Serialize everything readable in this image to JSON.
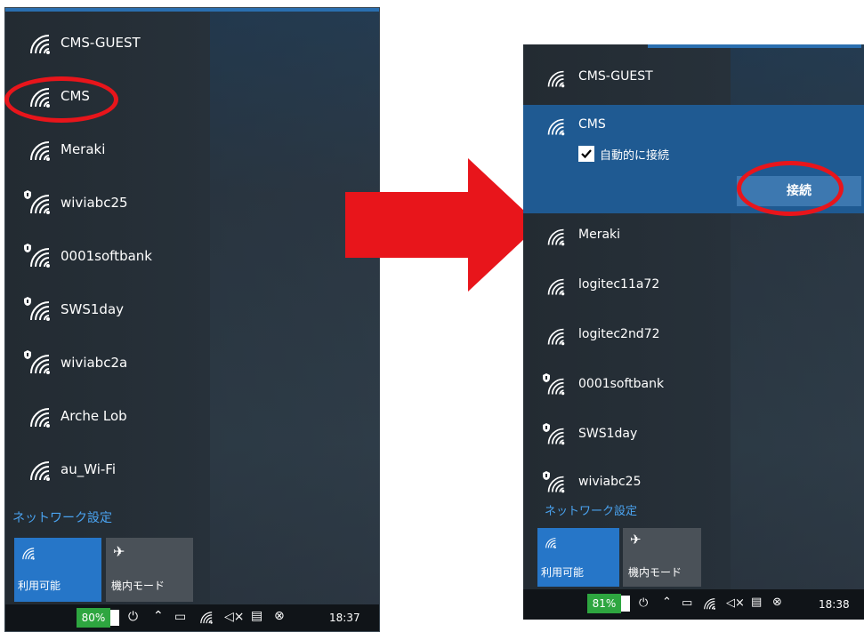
{
  "colors": {
    "accent": "#2676c8",
    "annotation": "#e8151b",
    "battery": "#2ea640",
    "link": "#4aa3f0"
  },
  "left": {
    "networks": [
      {
        "ssid": "CMS-GUEST",
        "secured": false
      },
      {
        "ssid": "CMS",
        "secured": false
      },
      {
        "ssid": "Meraki",
        "secured": false
      },
      {
        "ssid": "wiviabc25",
        "secured": true
      },
      {
        "ssid": "0001softbank",
        "secured": true
      },
      {
        "ssid": "SWS1day",
        "secured": true
      },
      {
        "ssid": "wiviabc2a",
        "secured": true
      },
      {
        "ssid": "Arche Lob",
        "secured": false
      },
      {
        "ssid": "au_Wi-Fi",
        "secured": false
      }
    ],
    "network_settings": "ネットワーク設定",
    "tiles": {
      "wifi_label": "利用可能",
      "airplane_label": "機内モード"
    },
    "taskbar": {
      "battery": "80%",
      "time": "18:37"
    }
  },
  "right": {
    "networks": [
      {
        "ssid": "CMS-GUEST",
        "secured": false
      },
      {
        "ssid": "CMS",
        "secured": false,
        "expanded": true
      },
      {
        "ssid": "Meraki",
        "secured": false
      },
      {
        "ssid": "logitec11a72",
        "secured": false
      },
      {
        "ssid": "logitec2nd72",
        "secured": false
      },
      {
        "ssid": "0001softbank",
        "secured": true
      },
      {
        "ssid": "SWS1day",
        "secured": true
      },
      {
        "ssid": "wiviabc25",
        "secured": true
      }
    ],
    "auto_connect_label": "自動的に接続",
    "auto_connect_checked": true,
    "connect_label": "接続",
    "network_settings": "ネットワーク設定",
    "tiles": {
      "wifi_label": "利用可能",
      "airplane_label": "機内モード"
    },
    "taskbar": {
      "battery": "81%",
      "time": "18:38"
    }
  }
}
